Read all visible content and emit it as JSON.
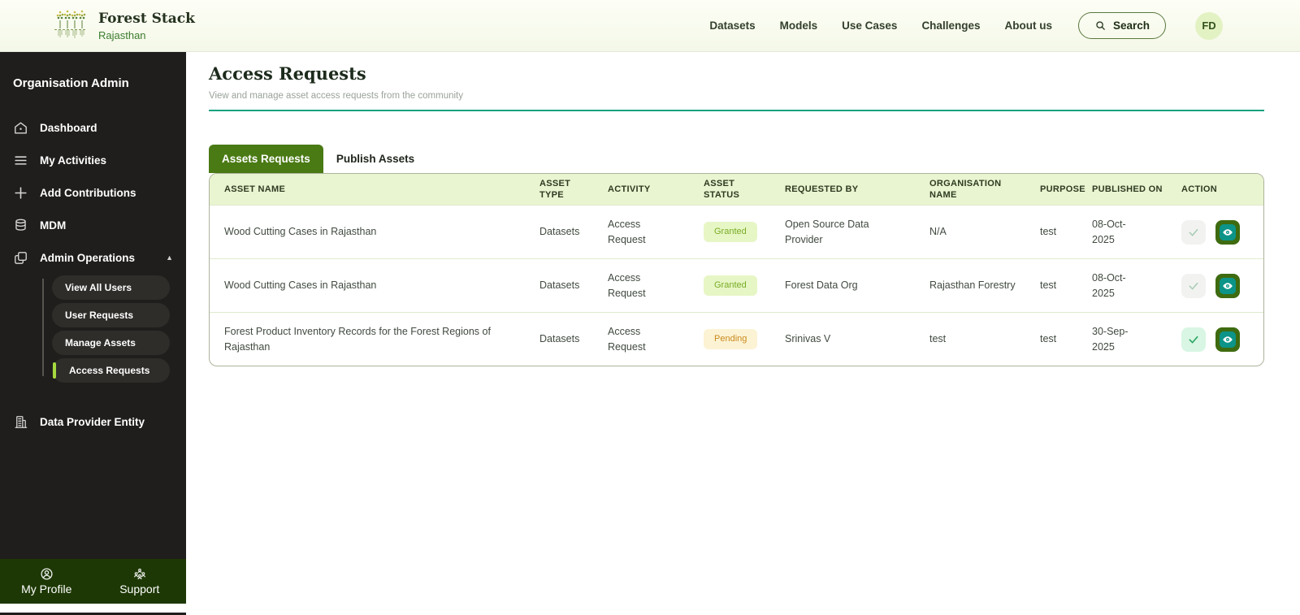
{
  "brand": {
    "title": "Forest Stack",
    "subtitle": "Rajasthan"
  },
  "nav": {
    "items": [
      {
        "label": "Datasets"
      },
      {
        "label": "Models"
      },
      {
        "label": "Use Cases"
      },
      {
        "label": "Challenges"
      },
      {
        "label": "About us"
      }
    ],
    "search_label": "Search",
    "avatar_initials": "FD"
  },
  "sidebar": {
    "heading": "Organisation Admin",
    "items": [
      {
        "label": "Dashboard",
        "icon": "home-icon"
      },
      {
        "label": "My Activities",
        "icon": "list-icon"
      },
      {
        "label": "Add Contributions",
        "icon": "plus-icon"
      },
      {
        "label": "MDM",
        "icon": "database-icon"
      },
      {
        "label": "Admin Operations",
        "icon": "layers-icon",
        "expanded": true
      }
    ],
    "admin_subitems": [
      {
        "label": "View All Users",
        "active": false
      },
      {
        "label": "User Requests",
        "active": false
      },
      {
        "label": "Manage Assets",
        "active": false
      },
      {
        "label": "Access Requests",
        "active": true
      }
    ],
    "bottom_item": {
      "label": "Data Provider Entity",
      "icon": "building-icon"
    },
    "footer": [
      {
        "label": "My Profile",
        "icon": "person-circle-icon"
      },
      {
        "label": "Support",
        "icon": "people-group-icon"
      }
    ]
  },
  "page": {
    "title": "Access Requests",
    "subtitle": "View and manage asset access requests from the community"
  },
  "tabs": [
    {
      "label": "Assets Requests",
      "active": true
    },
    {
      "label": "Publish Assets",
      "active": false
    }
  ],
  "table": {
    "columns": [
      "ASSET NAME",
      "ASSET TYPE",
      "ACTIVITY",
      "ASSET STATUS",
      "REQUESTED BY",
      "ORGANISATION NAME",
      "PURPOSE",
      "PUBLISHED ON",
      "ACTION"
    ],
    "rows": [
      {
        "asset_name": "Wood Cutting Cases in Rajasthan",
        "asset_type": "Datasets",
        "activity": "Access Request",
        "asset_status": "Granted",
        "requested_by": "Open Source Data Provider",
        "organisation_name": "N/A",
        "purpose": "test",
        "published_on": "08-Oct-2025",
        "approve_enabled": false
      },
      {
        "asset_name": "Wood Cutting Cases in Rajasthan",
        "asset_type": "Datasets",
        "activity": "Access Request",
        "asset_status": "Granted",
        "requested_by": "Forest Data Org",
        "organisation_name": "Rajasthan Forestry",
        "purpose": "test",
        "published_on": "08-Oct-2025",
        "approve_enabled": false
      },
      {
        "asset_name": "Forest Product Inventory Records for the Forest Regions of Rajasthan",
        "asset_type": "Datasets",
        "activity": "Access Request",
        "asset_status": "Pending",
        "requested_by": "Srinivas V",
        "organisation_name": "test",
        "purpose": "test",
        "published_on": "30-Sep-2025",
        "approve_enabled": true
      }
    ]
  },
  "colors": {
    "accent_green": "#4a7a14",
    "teal": "#0c9488",
    "divider_teal": "#12a181",
    "active_marker": "#a5d93e",
    "footer_green": "#1d3804",
    "table_header_bg": "#e9f4d1",
    "badge_granted_bg": "#e7f6c5",
    "badge_granted_text": "#78ac26",
    "badge_pending_bg": "#fcf3d4",
    "badge_pending_text": "#c98a1f"
  }
}
